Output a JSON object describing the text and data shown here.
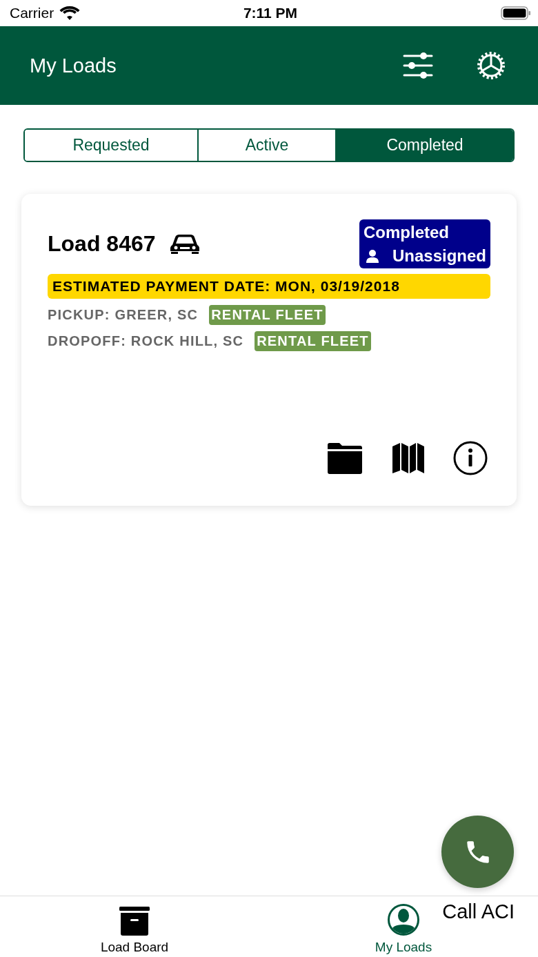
{
  "status_bar": {
    "carrier": "Carrier",
    "time": "7:11 PM"
  },
  "header": {
    "title": "My Loads"
  },
  "tabs": [
    {
      "label": "Requested",
      "selected": false
    },
    {
      "label": "Active",
      "selected": false
    },
    {
      "label": "Completed",
      "selected": true
    }
  ],
  "loads": [
    {
      "title": "Load 8467",
      "status": "Completed",
      "assignee": "Unassigned",
      "payment_date": "ESTIMATED PAYMENT DATE: MON, 03/19/2018",
      "stops": [
        {
          "text": "PICKUP: GREER, SC",
          "tag": "RENTAL FLEET"
        },
        {
          "text": "DROPOFF: ROCK HILL, SC",
          "tag": "RENTAL FLEET"
        }
      ]
    }
  ],
  "call_button": {
    "label": "Call ACI"
  },
  "tab_bar": [
    {
      "label": "Load Board",
      "kind": "archive",
      "selected": false
    },
    {
      "label": "My Loads",
      "kind": "person",
      "selected": true
    }
  ]
}
